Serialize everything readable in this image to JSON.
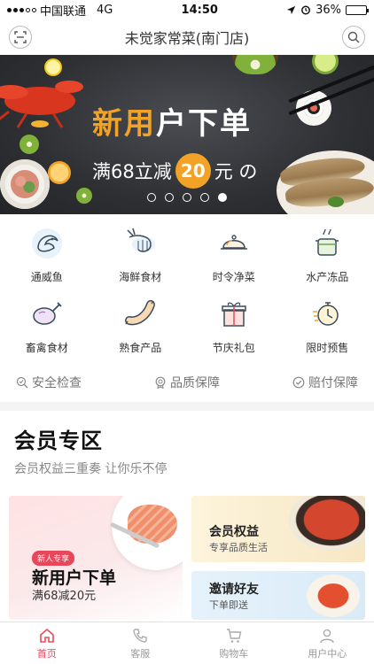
{
  "status_bar": {
    "carrier": "中国联通",
    "network": "4G",
    "time": "14:50",
    "battery": "36%",
    "battery_level": 0.36
  },
  "header": {
    "title": "未觉家常菜(南门店)",
    "scan_icon": "scan-icon",
    "search_icon": "search-icon"
  },
  "banner": {
    "headline_highlight": "新用",
    "headline_rest": "户下单",
    "sub_prefix": "满68立减",
    "sub_amount": "20",
    "sub_suffix": "元 の",
    "slides": 5,
    "active_slide": 5,
    "accent_color": "#f2a327"
  },
  "categories": [
    {
      "label": "通威鱼",
      "icon": "fish-icon"
    },
    {
      "label": "海鲜食材",
      "icon": "shrimp-icon"
    },
    {
      "label": "时令净菜",
      "icon": "cloche-icon"
    },
    {
      "label": "水产冻品",
      "icon": "pot-icon"
    },
    {
      "label": "畜禽食材",
      "icon": "drumstick-icon"
    },
    {
      "label": "熟食产品",
      "icon": "sausage-icon"
    },
    {
      "label": "节庆礼包",
      "icon": "gift-icon"
    },
    {
      "label": "限时预售",
      "icon": "timer-icon"
    }
  ],
  "guarantees": [
    {
      "label": "安全检查",
      "icon": "search-shield-icon"
    },
    {
      "label": "品质保障",
      "icon": "badge-icon"
    },
    {
      "label": "赔付保障",
      "icon": "check-circle-icon"
    }
  ],
  "member": {
    "title": "会员专区",
    "subtitle": "会员权益三重奏 让你乐不停"
  },
  "cards": {
    "big": {
      "tag": "新人专享",
      "title": "新用户下单",
      "subtitle": "满68减20元"
    },
    "small_a": {
      "title": "会员权益",
      "subtitle": "专享品质生活"
    },
    "small_b": {
      "title": "邀请好友",
      "subtitle": "下单即送"
    }
  },
  "tab_bar": {
    "items": [
      {
        "label": "首页",
        "icon": "home-icon",
        "active": true
      },
      {
        "label": "客服",
        "icon": "phone-icon",
        "active": false
      },
      {
        "label": "购物车",
        "icon": "cart-icon",
        "active": false
      },
      {
        "label": "用户中心",
        "icon": "user-icon",
        "active": false
      }
    ],
    "active_color": "#e84b5c"
  }
}
